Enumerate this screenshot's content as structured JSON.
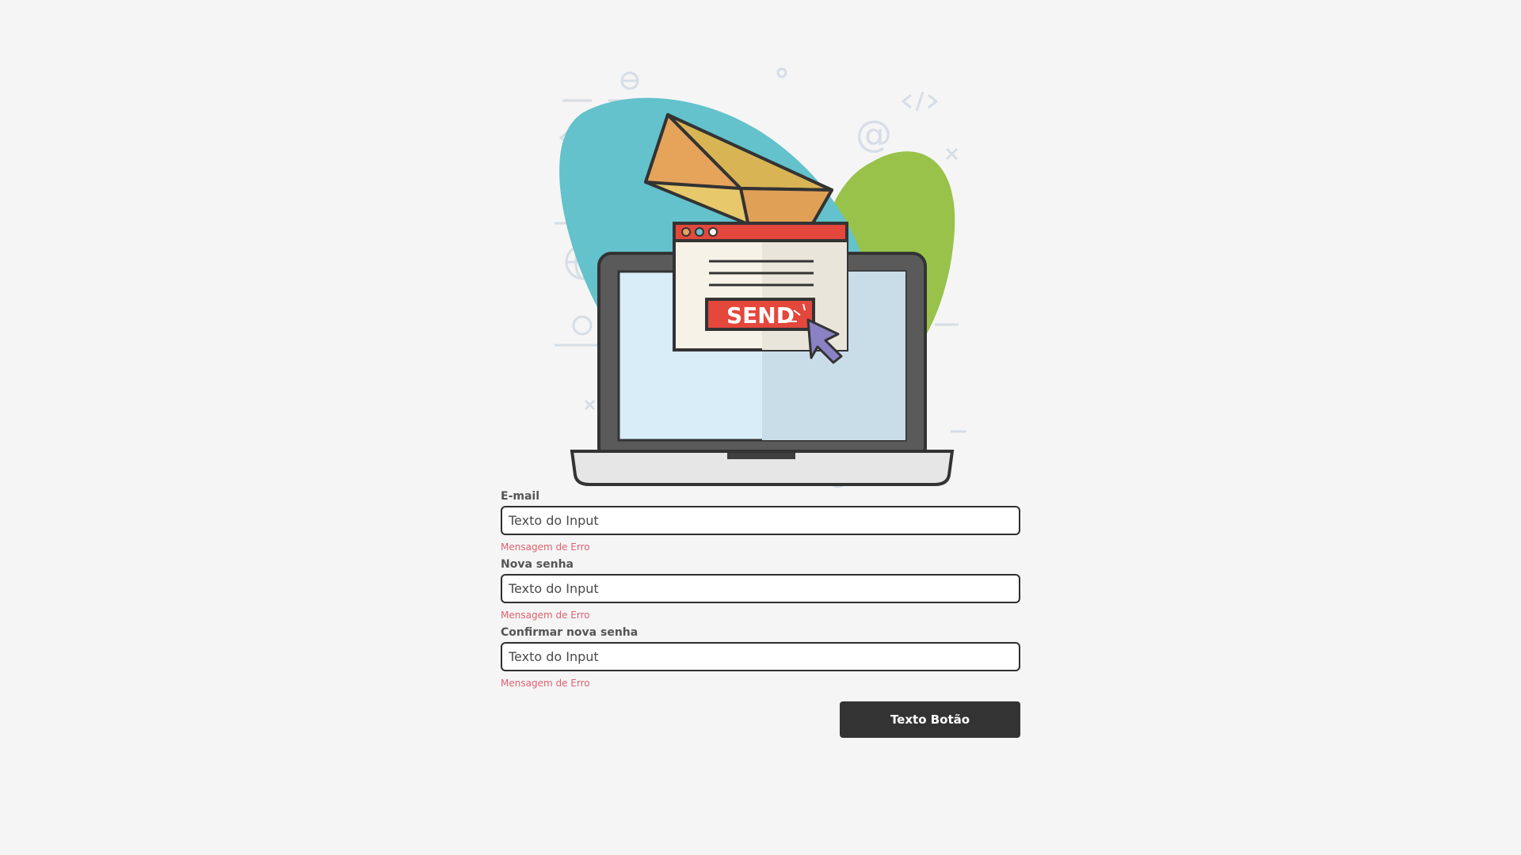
{
  "illustration": {
    "send_text": "SEND",
    "colors": {
      "blob_teal": "#63c2cb",
      "blob_green": "#98c24a",
      "send_red": "#e4473c",
      "cursor_purple": "#8a82c4"
    }
  },
  "form": {
    "fields": [
      {
        "label": "E-mail",
        "placeholder": "Texto do Input",
        "error": "Mensagem de Erro"
      },
      {
        "label": "Nova senha",
        "placeholder": "Texto do Input",
        "error": "Mensagem de Erro"
      },
      {
        "label": "Confirmar nova senha",
        "placeholder": "Texto do Input",
        "error": "Mensagem de Erro"
      }
    ],
    "submit_label": "Texto Botão"
  },
  "colors": {
    "background": "#f5f5f5",
    "error": "#e0616f",
    "button": "#333333"
  }
}
